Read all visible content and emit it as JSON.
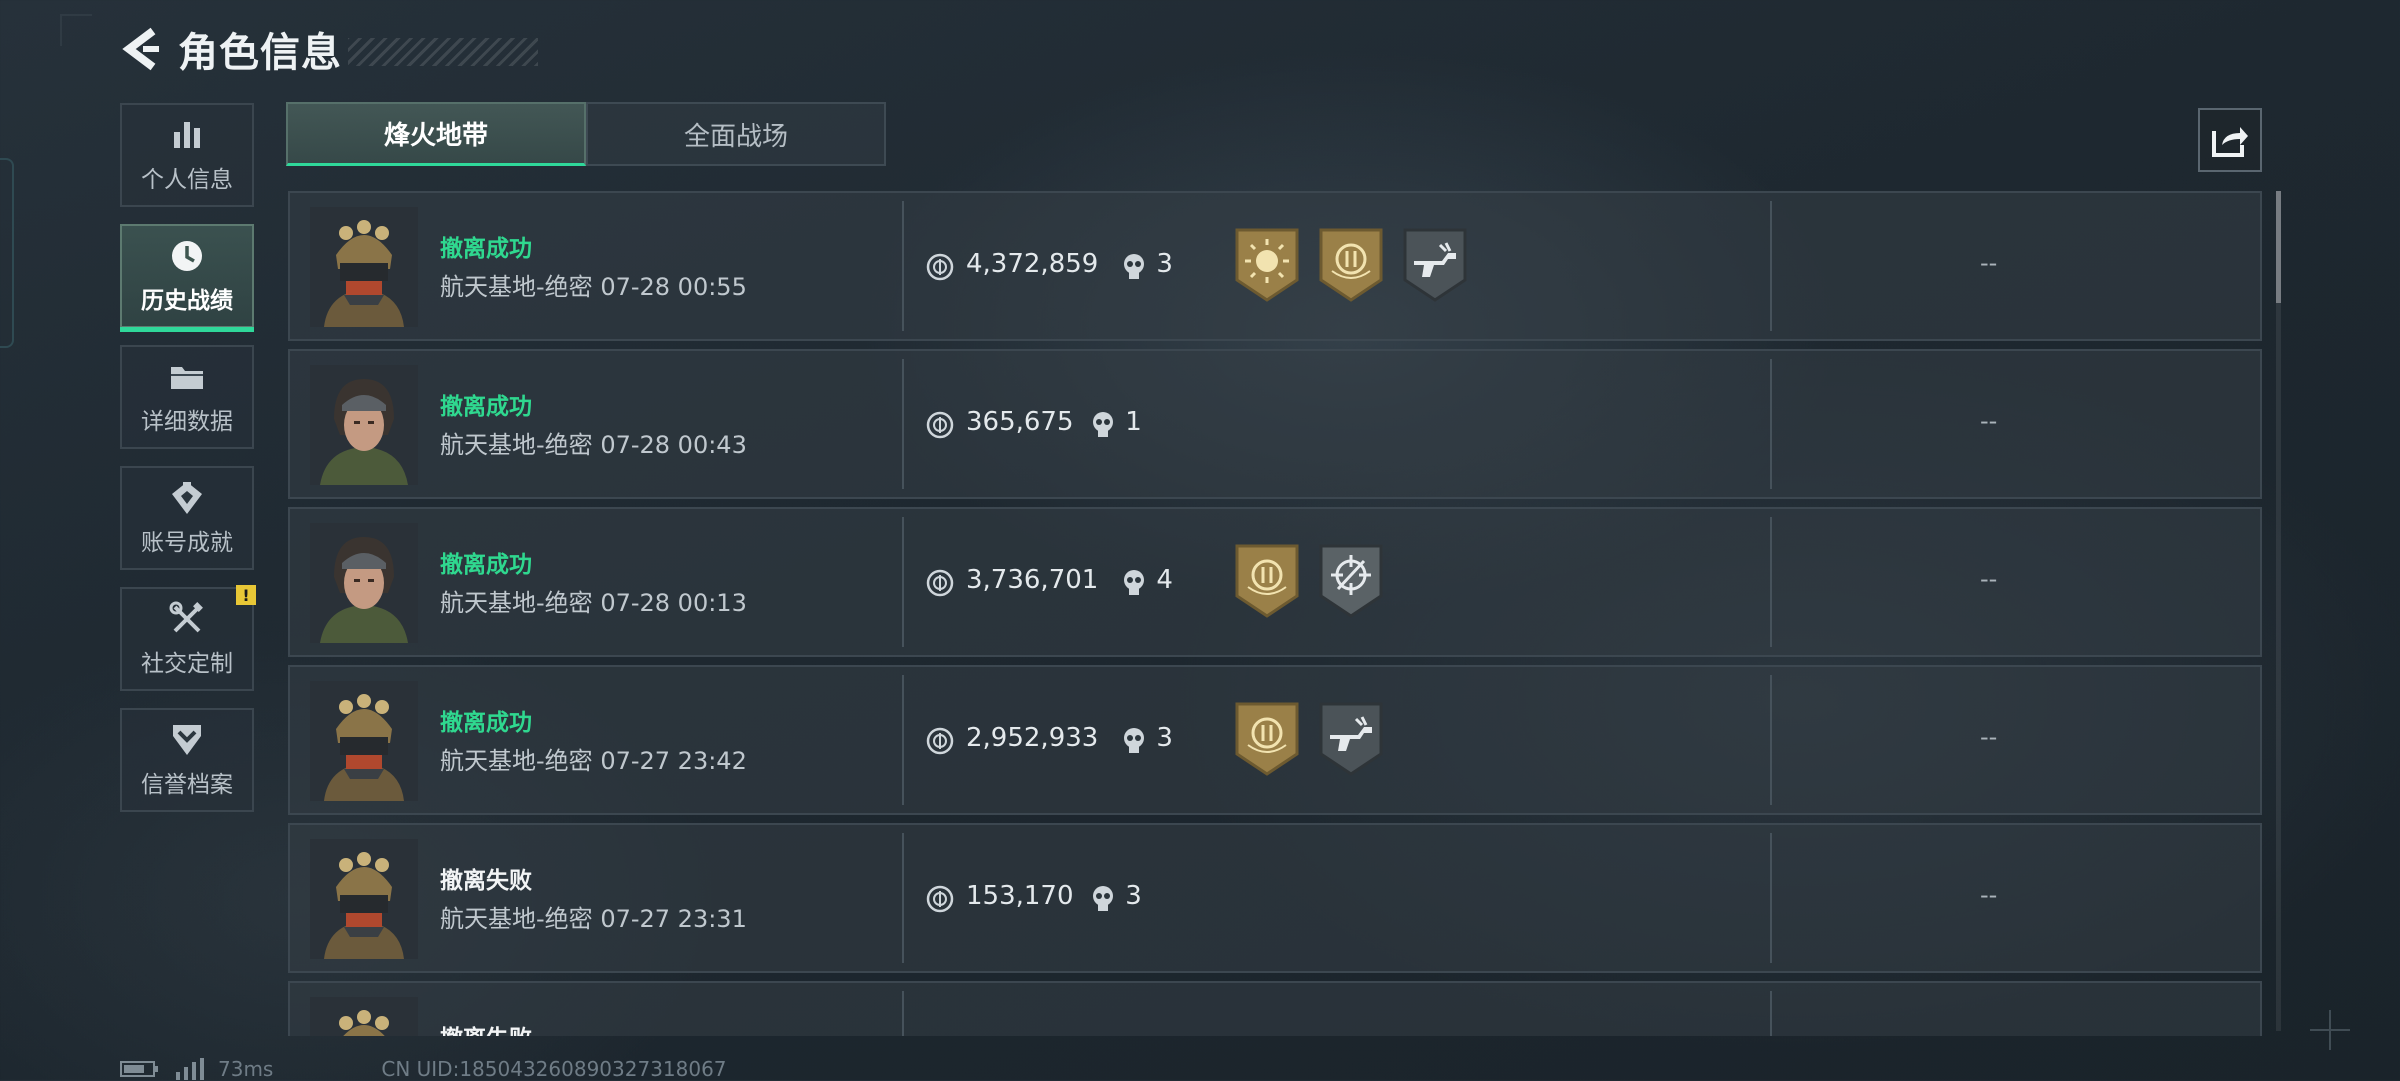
{
  "header": {
    "title": "角色信息"
  },
  "sidebar": {
    "items": [
      {
        "label": "个人信息",
        "icon": "bar-chart-icon",
        "active": false,
        "badge": ""
      },
      {
        "label": "历史战绩",
        "icon": "clock-icon",
        "active": true,
        "badge": ""
      },
      {
        "label": "详细数据",
        "icon": "folder-icon",
        "active": false,
        "badge": ""
      },
      {
        "label": "账号成就",
        "icon": "achievement-icon",
        "active": false,
        "badge": ""
      },
      {
        "label": "社交定制",
        "icon": "wrench-screwdriver-icon",
        "active": false,
        "badge": "!"
      },
      {
        "label": "信誉档案",
        "icon": "shield-chevron-icon",
        "active": false,
        "badge": ""
      }
    ]
  },
  "tabs": [
    {
      "label": "烽火地带",
      "active": true
    },
    {
      "label": "全面战场",
      "active": false
    }
  ],
  "share": {
    "icon": "share-export-icon"
  },
  "records": [
    {
      "status": "撤离成功",
      "success": true,
      "map": "航天基地-绝密",
      "time": "07-28 00:55",
      "value": "4,372,859",
      "kills": "3",
      "avatar": "helmet-soldier",
      "medals": [
        "sun-gold-medal-icon",
        "coin-gold-medal-icon",
        "gun-silver-medal-icon"
      ],
      "extra": "--"
    },
    {
      "status": "撤离成功",
      "success": true,
      "map": "航天基地-绝密",
      "time": "07-28 00:43",
      "value": "365,675",
      "kills": "1",
      "avatar": "female-operator",
      "medals": [],
      "extra": "--"
    },
    {
      "status": "撤离成功",
      "success": true,
      "map": "航天基地-绝密",
      "time": "07-28 00:13",
      "value": "3,736,701",
      "kills": "4",
      "avatar": "female-operator",
      "medals": [
        "coin-gold-medal-icon",
        "crosshair-silver-medal-icon"
      ],
      "extra": "--"
    },
    {
      "status": "撤离成功",
      "success": true,
      "map": "航天基地-绝密",
      "time": "07-27 23:42",
      "value": "2,952,933",
      "kills": "3",
      "avatar": "helmet-soldier",
      "medals": [
        "coin-gold-medal-icon",
        "gun-silver-medal-icon"
      ],
      "extra": "--"
    },
    {
      "status": "撤离失败",
      "success": false,
      "map": "航天基地-绝密",
      "time": "07-27 23:31",
      "value": "153,170",
      "kills": "3",
      "avatar": "helmet-soldier",
      "medals": [],
      "extra": "--"
    },
    {
      "status": "撤离失败",
      "success": false,
      "map": "",
      "time": "",
      "value": "",
      "kills": "",
      "avatar": "helmet-soldier",
      "medals": [],
      "extra": ""
    }
  ],
  "footer": {
    "ping": "73ms",
    "uid": "CN UID:1850432608903273180​67"
  },
  "colors": {
    "accent": "#2fd89a",
    "success": "#2fd88f",
    "badge": "#e8c736"
  }
}
